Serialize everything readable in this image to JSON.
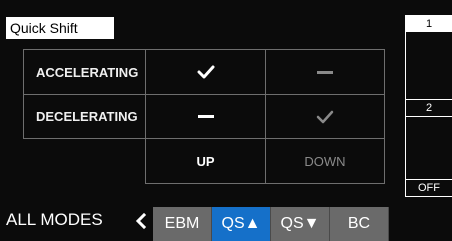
{
  "title": "Quick Shift",
  "table": {
    "rows": [
      {
        "label": "ACCELERATING",
        "up": "check",
        "down": "dash"
      },
      {
        "label": "DECELERATING",
        "up": "dash",
        "down": "check"
      }
    ],
    "columns": {
      "up": "UP",
      "down": "DOWN"
    },
    "active_column": "up"
  },
  "sidebar": {
    "levels": [
      "1",
      "2",
      "OFF"
    ],
    "selected": "1"
  },
  "bottom": {
    "modes_label": "ALL MODES",
    "tabs": [
      {
        "label": "EBM",
        "active": false
      },
      {
        "label": "QS▲",
        "active": true
      },
      {
        "label": "QS▼",
        "active": false
      },
      {
        "label": "BC",
        "active": false
      }
    ]
  },
  "colors": {
    "active_tab": "#1570c9",
    "inactive_tab": "#6a6a6a",
    "dim": "#8a8a8a"
  }
}
